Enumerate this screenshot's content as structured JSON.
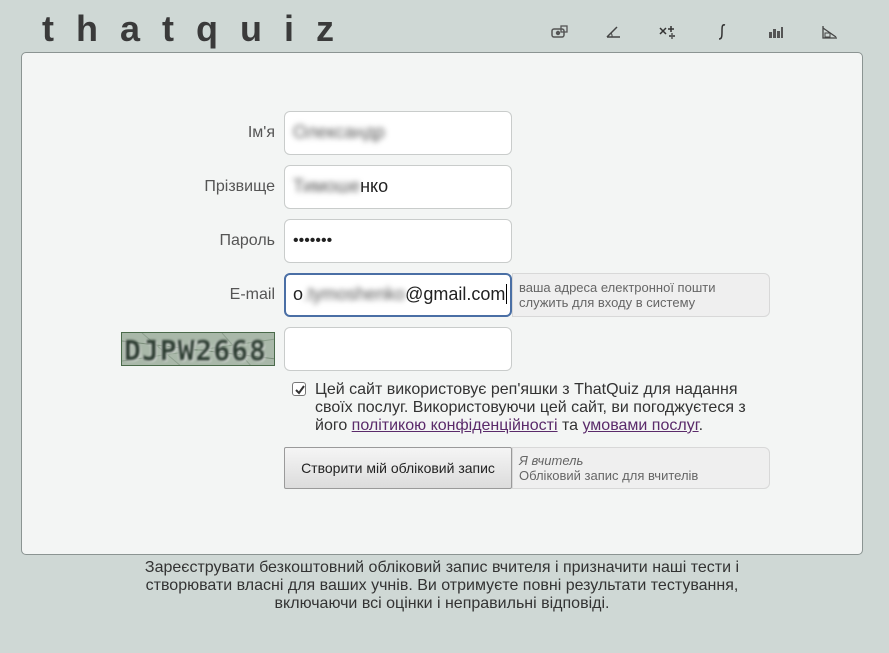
{
  "app": {
    "logo": "thatquiz"
  },
  "toolbar": {
    "icons": [
      "fractions-icon",
      "geometry-icon",
      "arithmetic-icon",
      "calculus-icon",
      "statistics-icon",
      "graphing-icon"
    ]
  },
  "form": {
    "first_name_label": "Ім'я",
    "first_name_value": "Олександр",
    "last_name_label": "Прізвище",
    "last_name_value_blurred": "Тимоше",
    "last_name_value_visible": "нко",
    "password_label": "Пароль",
    "password_value": "•••••••",
    "email_label": "E-mail",
    "email_value_start": "o",
    "email_value_blurred": ".tymoshenko",
    "email_value_end": "@gmail.com",
    "email_hint": "ваша адреса електронної пошти служить для входу в систему",
    "captcha_text": "DJPW2668",
    "captcha_value": ""
  },
  "consent": {
    "checked": true,
    "text_before": "Цей сайт використовує реп'яшки з ThatQuiz для надання своїх послуг. Використовуючи цей сайт, ви погоджуєтеся з його ",
    "privacy_link": "політикою конфіденційності",
    "text_middle": " та ",
    "terms_link": "умовами послуг",
    "text_after": "."
  },
  "actions": {
    "submit_label": "Створити мій обліковий запис",
    "teacher_title": "Я вчитель",
    "teacher_subtitle": "Обліковий запис для вчителів"
  },
  "footer": {
    "text": "Зареєструвати безкоштовний обліковий запис вчителя і призначити наші тести і створювати власні для ваших учнів. Ви отримуєте повні результати тестування, включаючи всі оцінки і неправильні відповіді."
  },
  "colors": {
    "background": "#cfd8d5",
    "panel": "#f3f5f4",
    "focus_border": "#4a6fa5",
    "link": "#5a2a6a"
  }
}
